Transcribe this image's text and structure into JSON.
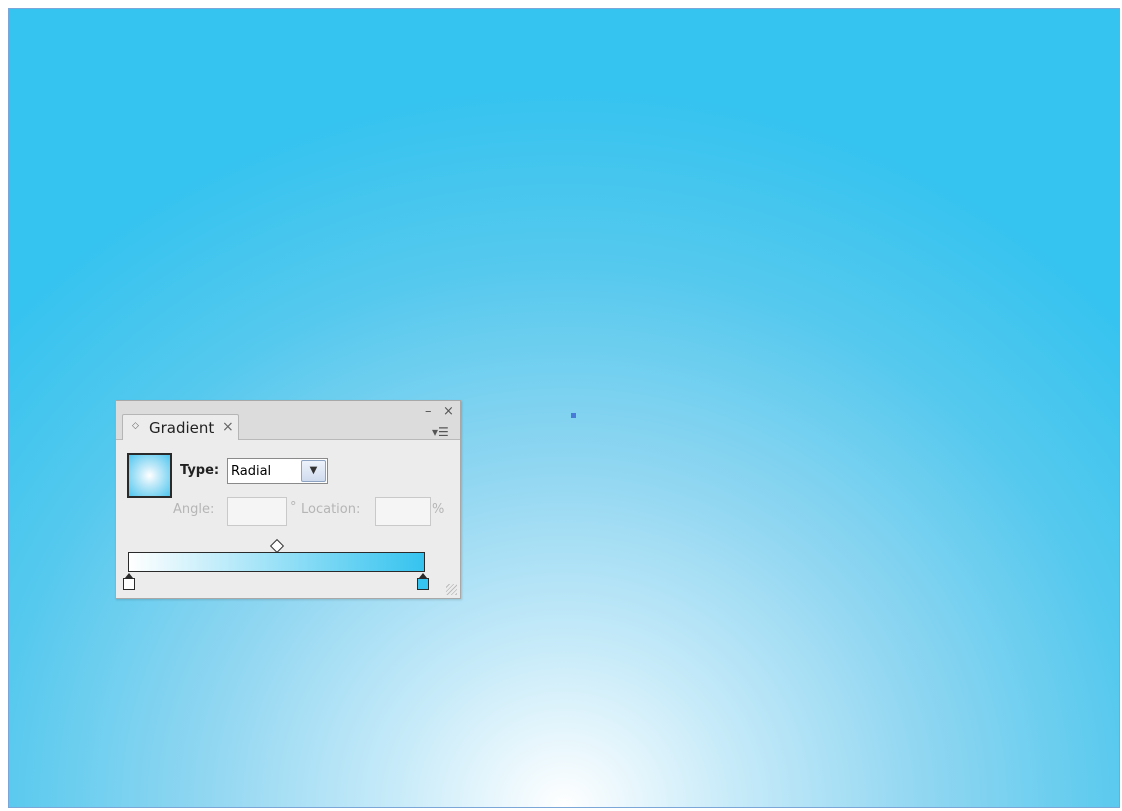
{
  "panel": {
    "tab_label": "Gradient",
    "tab_close_icon": "×",
    "minimize_icon": "–",
    "close_icon": "×",
    "menu_icon": "▾☰",
    "tab_arrows_icon": "◇",
    "type_label": "Type:",
    "type_value": "Radial",
    "type_dropdown_icon": "▼",
    "angle_label": "Angle:",
    "angle_value": "",
    "angle_unit": "°",
    "location_label": "Location:",
    "location_value": "",
    "location_unit": "%"
  },
  "gradient": {
    "type": "radial",
    "stops": [
      {
        "color": "#ffffff",
        "location": 0
      },
      {
        "color": "#35c3ef",
        "location": 100
      }
    ],
    "midpoint": 50
  },
  "colors": {
    "canvas_outer": "#35c3ef",
    "canvas_inner": "#ffffff",
    "anchor_point": "#4a7ad8"
  }
}
